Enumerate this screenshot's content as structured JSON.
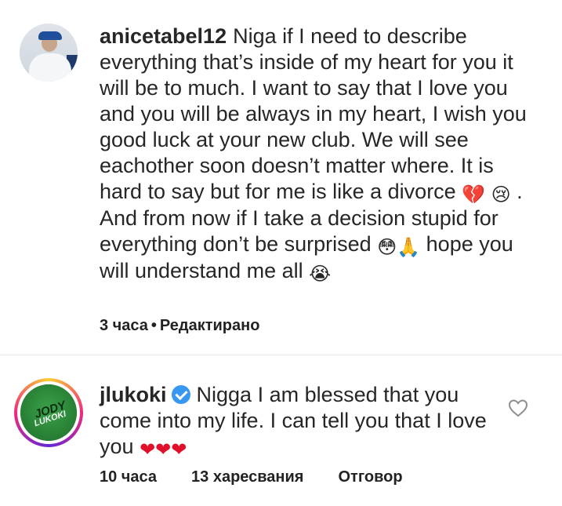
{
  "comments": [
    {
      "username": "anicetabel12",
      "text": "Niga if I need to describe everything that’s inside of my heart for you it will be to much. I want to say that I love you and you will be always in my heart, I wish you good luck at your new club. We will see eachother soon doesn’t matter where. It is hard to say but for me is like a divorce",
      "text_after_emoji1": ". And from now if I take a decision stupid for everything don’t be surprised",
      "text_after_emoji2": "hope you will understand me all",
      "emojis": [
        "💔",
        "😢",
        "😳",
        "🙏",
        "😭"
      ],
      "time": "3 часа",
      "separator": "•",
      "edited": "Редактирано"
    },
    {
      "username": "jlukoki",
      "verified": true,
      "text": "Nigga I am blessed that you come into my life. I can tell you that I love you",
      "emojis": [
        "❤",
        "❤",
        "❤"
      ],
      "time": "10 часа",
      "likes": "13 харесвания",
      "reply": "Отговор",
      "avatar_text": [
        "JODY",
        "LUKOKI"
      ]
    }
  ],
  "colors": {
    "verified": "#3897f0",
    "heart": "#e0102b",
    "text": "#262626"
  },
  "icons": {
    "like": "heart-outline-icon",
    "verified": "verified-badge-icon"
  }
}
